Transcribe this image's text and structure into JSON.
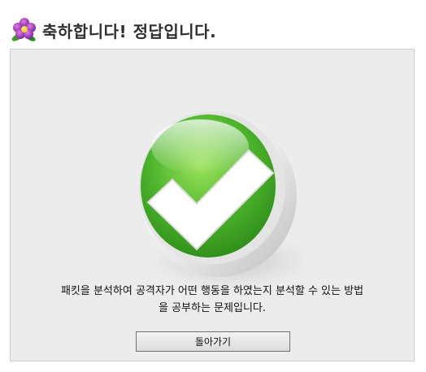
{
  "header": {
    "icon": "flower-icon",
    "title": "축하합니다! 정답입니다."
  },
  "panel": {
    "illustration": "check-icon",
    "message_line1": "패킷을 분석하여 공격자가 어떤 행동을 하였는지 분석할 수 있는 방법",
    "message_line2": "을 공부하는 문제입니다.",
    "back_button_label": "돌아가기"
  },
  "colors": {
    "check_green": "#4cb32c",
    "panel_bg": "#ececec",
    "flower_petal": "#9b2fb4",
    "leaf_green": "#3e9a2a"
  }
}
